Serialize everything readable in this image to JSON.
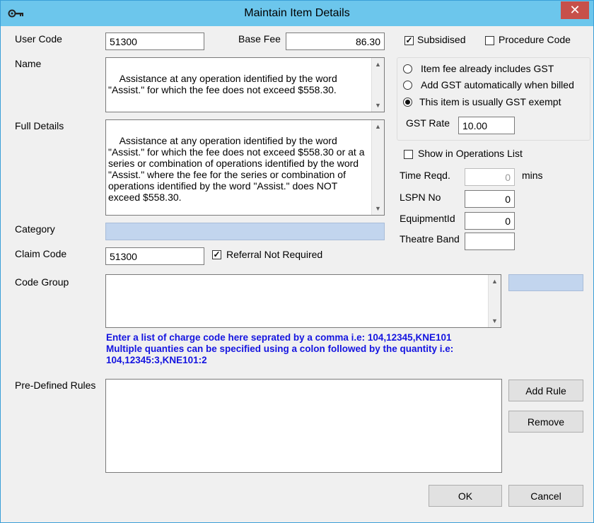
{
  "window": {
    "title": "Maintain Item Details",
    "close_glyph": "✕"
  },
  "fields": {
    "user_code": {
      "label": "User Code",
      "value": "51300"
    },
    "base_fee": {
      "label": "Base Fee",
      "value": "86.30"
    },
    "name": {
      "label": "Name",
      "value": "Assistance at any operation identified by the word \"Assist.\" for which the fee does not exceed $558.30."
    },
    "full_details": {
      "label": "Full Details",
      "value": "Assistance at any operation identified by the word \"Assist.\" for which the fee does not exceed $558.30 or at a series or combination of operations identified by the word \"Assist.\" where the fee for the series or combination of operations identified by the word \"Assist.\" does NOT exceed $558.30."
    },
    "category": {
      "label": "Category",
      "value": ""
    },
    "claim_code": {
      "label": "Claim Code",
      "value": "51300"
    },
    "code_group": {
      "label": "Code Group",
      "value": ""
    },
    "predefined_rules": {
      "label": "Pre-Defined Rules"
    }
  },
  "checkboxes": {
    "subsidised": {
      "label": "Subsidised",
      "checked": true
    },
    "procedure_code": {
      "label": "Procedure Code",
      "checked": false
    },
    "referral_not_required": {
      "label": "Referral Not Required",
      "checked": true
    },
    "show_in_operations_list": {
      "label": "Show in Operations List",
      "checked": false
    }
  },
  "gst": {
    "options": [
      {
        "label": "Item fee already includes GST",
        "selected": false
      },
      {
        "label": "Add GST automatically when billed",
        "selected": false
      },
      {
        "label": "This item is usually GST exempt",
        "selected": true
      }
    ],
    "rate_label": "GST Rate",
    "rate_value": "10.00"
  },
  "operations": {
    "time_reqd": {
      "label": "Time Reqd.",
      "value": "0",
      "unit": "mins"
    },
    "lspn_no": {
      "label": "LSPN No",
      "value": "0"
    },
    "equipment_id": {
      "label": "EquipmentId",
      "value": "0"
    },
    "theatre_band": {
      "label": "Theatre Band",
      "value": ""
    }
  },
  "hints": {
    "line1": "Enter a list of charge code here seprated by a comma i.e: 104,12345,KNE101",
    "line2": "Multiple quanties can be specified using a colon followed by the quantity i.e:",
    "line3": "104,12345:3,KNE101:2"
  },
  "buttons": {
    "add_rule": "Add Rule",
    "remove": "Remove",
    "ok": "OK",
    "cancel": "Cancel"
  },
  "icons": {
    "scroll_up": "▲",
    "scroll_down": "▼",
    "check_mark": "✓"
  },
  "colors": {
    "titlebar": "#6cc6ec",
    "close": "#c7504a",
    "hint_text": "#1414e0",
    "readonly_field": "#c2d5ee"
  }
}
